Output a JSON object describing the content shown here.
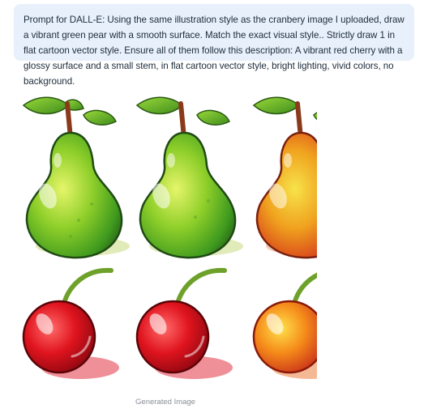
{
  "prompt": {
    "text": "Prompt for DALL-E: Using the same illustration style as the cranbery image I uploaded, draw a vibrant green pear with a smooth surface. Match the exact visual style.. Strictly draw 1 in flat cartoon vector style. Ensure all of them follow this description: A vibrant red cherry with a glossy surface and a small stem, in flat cartoon vector style, bright lighting, vivid colors, no background."
  },
  "image": {
    "caption": "Generated Image",
    "tiles": [
      {
        "row": 1,
        "fruit": "pear",
        "variant": "green"
      },
      {
        "row": 1,
        "fruit": "pear",
        "variant": "green"
      },
      {
        "row": 1,
        "fruit": "pear",
        "variant": "red-yellow"
      },
      {
        "row": 2,
        "fruit": "cherry",
        "variant": "red"
      },
      {
        "row": 2,
        "fruit": "cherry",
        "variant": "red"
      },
      {
        "row": 2,
        "fruit": "cherry",
        "variant": "orange"
      }
    ]
  },
  "colors": {
    "bubble_bg": "#e8f1fb",
    "text": "#1d2b3a",
    "caption": "#8a8f96"
  }
}
